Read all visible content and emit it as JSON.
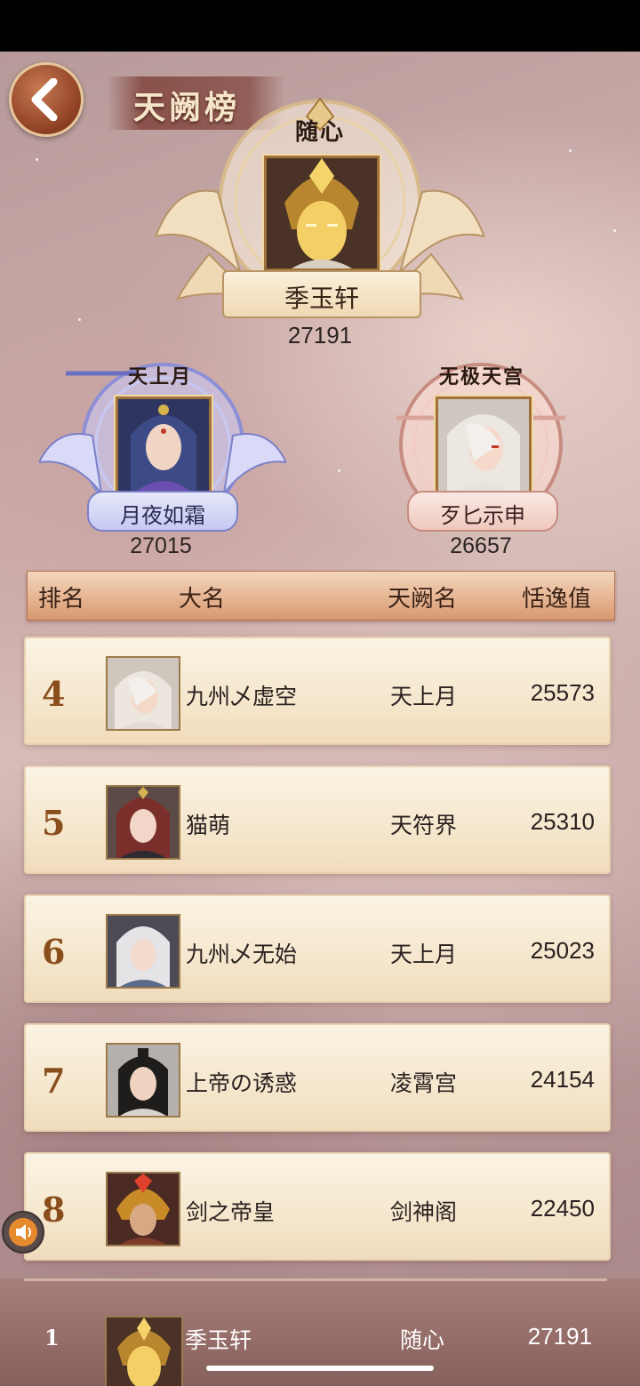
{
  "header": {
    "title": "天阙榜",
    "back_icon": "chevron-left-icon"
  },
  "podium": {
    "first": {
      "guild": "随心",
      "name": "季玉轩",
      "score": "27191"
    },
    "second": {
      "guild": "天上月",
      "name": "月夜如霜",
      "score": "27015"
    },
    "third": {
      "guild": "无极天宫",
      "name": "歹匕示申",
      "score": "26657"
    }
  },
  "table": {
    "headers": {
      "rank": "排名",
      "name": "大名",
      "guild": "天阙名",
      "score": "恬逸值"
    },
    "rows": [
      {
        "rank": "4",
        "name": "九州乄虚空",
        "guild": "天上月",
        "score": "25573"
      },
      {
        "rank": "5",
        "name": "猫萌",
        "guild": "天符界",
        "score": "25310"
      },
      {
        "rank": "6",
        "name": "九州乄无始",
        "guild": "天上月",
        "score": "25023"
      },
      {
        "rank": "7",
        "name": "上帝の诱惑",
        "guild": "凌霄宫",
        "score": "24154"
      },
      {
        "rank": "8",
        "name": "剑之帝皇",
        "guild": "剑神阁",
        "score": "22450"
      }
    ]
  },
  "my_rank": {
    "rank": "1",
    "name": "季玉轩",
    "guild": "随心",
    "score": "27191"
  },
  "colors": {
    "accent": "#8a4e1c",
    "header_bar": "#e6b592",
    "row_bg": "#f5e7cd"
  }
}
